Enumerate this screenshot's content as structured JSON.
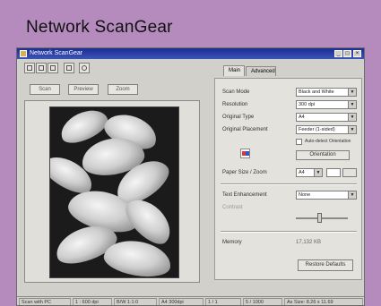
{
  "heading": "Network ScanGear",
  "window": {
    "title": "Network ScanGear",
    "controls": {
      "minimize": "_",
      "maximize": "□",
      "close": "×"
    }
  },
  "toolbar": {
    "icons": [
      "new-icon",
      "copy-icon",
      "paste-icon",
      "copy-icon-2",
      "help-icon"
    ]
  },
  "tabs": [
    "Main",
    "Advanced"
  ],
  "preview_buttons": [
    "Scan",
    "Preview",
    "Zoom"
  ],
  "settings": [
    {
      "label": "Scan Mode",
      "value": "Black and White"
    },
    {
      "label": "Resolution",
      "value": "300 dpi"
    },
    {
      "label": "Original Type",
      "value": "A4"
    },
    {
      "label": "Original Placement",
      "value": "Feeder (1-sided)"
    }
  ],
  "auto_detect_label": "Auto-detect Orientation",
  "orientation_button": "Orientation",
  "paper_size": {
    "label": "Paper Size / Zoom",
    "value": "A4"
  },
  "scan_options": {
    "label": "Text Enhancement",
    "value": "None"
  },
  "contrast_label": "Contrast",
  "memory": {
    "label": "Memory",
    "value": "17,132 KB"
  },
  "restore_button": "Restore Defaults",
  "statusbar": [
    "Scan with PC",
    "1 : 600 dpi",
    "B/W 1:1:0",
    "A4 300dpi",
    "1 / 1",
    "5 / 1000",
    "As Size: 8.26 x 11.69"
  ]
}
